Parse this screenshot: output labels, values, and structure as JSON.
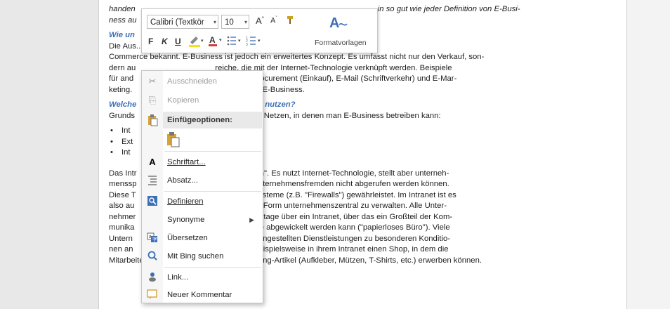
{
  "doc": {
    "line1a": "handen",
    "line1b": "in so gut wie jeder Definition von E-Busi-",
    "line2": "ness au",
    "h1": "Wie un",
    "p1": [
      "Die Aus... seit einigen Jahren unter dem Begriff E-",
      "Commerce bekannt. E-Business ist jedoch ein erweitertes Konzept. Es umfasst nicht nur den Verkauf, son-",
      "dern au                                    reiche, die mit der Internet-Technologie verknüpft werden. Beispiele",
      "für and                                    ess sind E-Procurement (Einkauf), E-Mail (Schriftverkehr) und E-Mar-",
      "keting.                                    termenge von E-Business."
    ],
    "h2a": "Welche",
    "h2b": "ness nutzen?",
    "p2a": "Grunds",
    "p2b": "on Netzen, in denen man E-Business betreiben kann:",
    "bullets": [
      "Int",
      "Ext",
      "Int"
    ],
    "p3": [
      "Das Intr                                    Unternehmen\". Es nutzt Internet-Technologie, stellt aber unterneh-",
      "menssp                                    g, die von Unternehmensfremden nicht abgerufen werden können.",
      "Diese T                                    Sicherheitssysteme (z.B. \"Firewalls\") gewährleistet. Im Intranet ist es",
      "also au                                    en in digitaler Form unternehmenszentral zu verwalten. Alle Unter-",
      "nehmer                                    rfügen heutzutage über ein Intranet, über das ein Großteil der Kom-",
      "munika                                    Medienbrüche abgewickelt werden kann (\"papierloses Büro\"). Viele",
      "Untern                                    ch, um ihren Angestellten Dienstleistungen zu besonderen Konditio-",
      "nen an                                    AG betreibt beispielsweise in ihrem Intranet einen Shop, in dem die",
      "Mitarbeiter online firmeneigene Merchandising-Artikel (Aufkleber, Mützen, T-Shirts, etc.) erwerben können."
    ]
  },
  "minitoolbar": {
    "font": "Calibri (Textkör",
    "size": "10",
    "grow": "A",
    "shrink": "A",
    "bold": "F",
    "italic": "K",
    "underline": "U",
    "styles_label": "Formatvorlagen"
  },
  "context_menu": {
    "cut": "Ausschneiden",
    "copy": "Kopieren",
    "paste_header": "Einfügeoptionen:",
    "font": "Schriftart...",
    "paragraph": "Absatz...",
    "define": "Definieren",
    "synonyms": "Synonyme",
    "translate": "Übersetzen",
    "bing": "Mit Bing suchen",
    "link": "Link...",
    "comment": "Neuer Kommentar"
  },
  "colors": {
    "heading": "#3d6fb6",
    "font_color_red": "#d23c3c",
    "highlight_yellow": "#f2e21a"
  }
}
